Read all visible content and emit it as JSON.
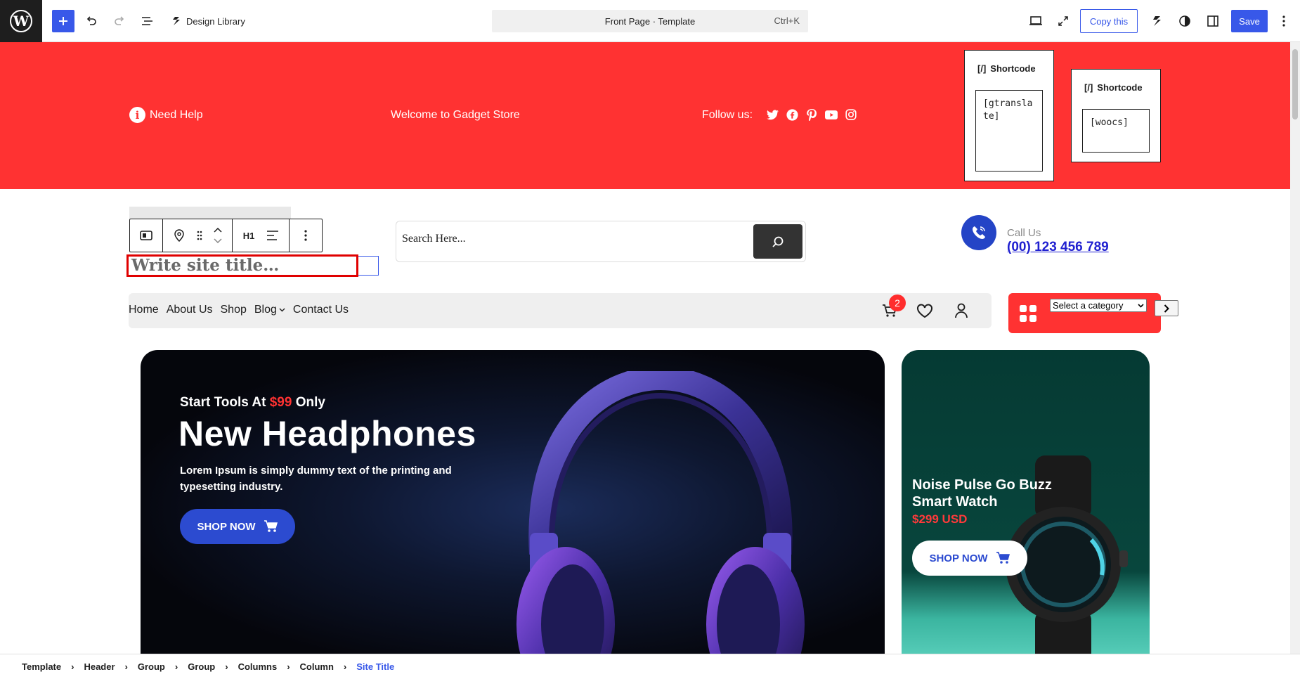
{
  "toolbar": {
    "design_library": "Design Library",
    "command_bar": "Front Page · Template",
    "command_shortcut": "Ctrl+K",
    "copy_label": "Copy this",
    "save_label": "Save"
  },
  "top_band": {
    "need_help": "Need Help",
    "welcome": "Welcome to Gadget Store",
    "follow": "Follow us:",
    "socials": [
      "twitter-icon",
      "facebook-icon",
      "pinterest-icon",
      "youtube-icon",
      "instagram-icon"
    ],
    "shortcodes": [
      {
        "label": "Shortcode",
        "icon": "[/]",
        "content": "[gtranslate]"
      },
      {
        "label": "Shortcode",
        "icon": "[/]",
        "content": "[woocs]"
      }
    ]
  },
  "header": {
    "block_toolbar": {
      "heading_level": "H1"
    },
    "site_title_placeholder": "Write site title…",
    "search_placeholder": "Search Here...",
    "call_label": "Call Us",
    "call_number": "(00) 123 456 789"
  },
  "nav": {
    "items": [
      "Home",
      "About Us",
      "Shop",
      "Blog",
      "Contact Us"
    ],
    "cart_count": "2",
    "category_select": "Select a category"
  },
  "hero": {
    "kicker_prefix": "Start Tools At",
    "kicker_price": "$99",
    "kicker_suffix": "Only",
    "title": "New Headphones",
    "description": "Lorem Ipsum is simply dummy text of the printing and typesetting industry.",
    "button": "SHOP NOW"
  },
  "side_card": {
    "title": "Noise Pulse Go Buzz Smart Watch",
    "price": "$299 USD",
    "button": "SHOP NOW"
  },
  "breadcrumb": [
    "Template",
    "Header",
    "Group",
    "Group",
    "Columns",
    "Column",
    "Site Title"
  ],
  "colors": {
    "accent": "#3858e9",
    "brand_red": "#ff3232",
    "hero_button": "#2c4bd0"
  }
}
